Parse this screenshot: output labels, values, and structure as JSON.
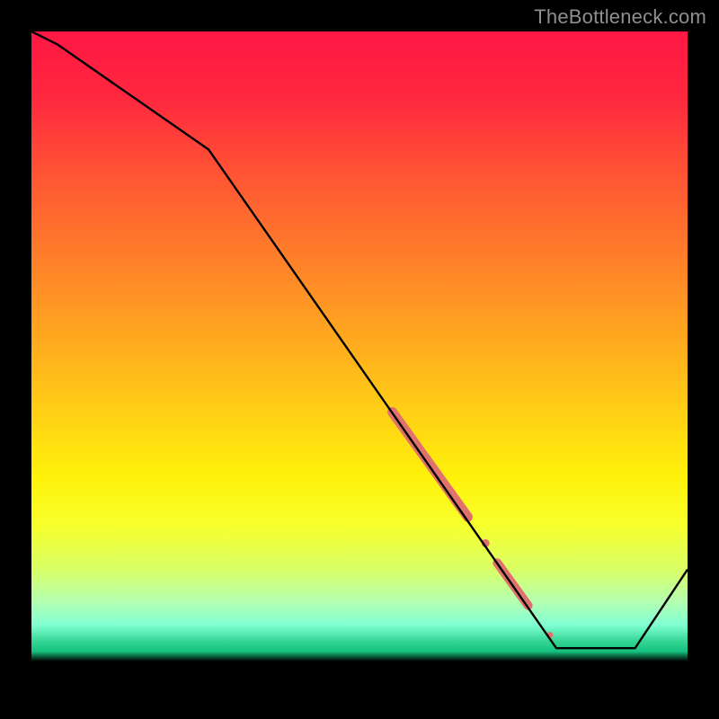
{
  "watermark": "TheBottleneck.com",
  "chart_data": {
    "type": "line",
    "title": "",
    "xlabel": "",
    "ylabel": "",
    "xlim": [
      0,
      100
    ],
    "ylim": [
      0,
      100
    ],
    "grid": false,
    "legend": false,
    "background_gradient_stops": [
      {
        "offset": 0.0,
        "color": "#ff1744"
      },
      {
        "offset": 0.1,
        "color": "#ff283f"
      },
      {
        "offset": 0.22,
        "color": "#ff5534"
      },
      {
        "offset": 0.34,
        "color": "#ff7d2a"
      },
      {
        "offset": 0.46,
        "color": "#ffa61f"
      },
      {
        "offset": 0.58,
        "color": "#ffcf15"
      },
      {
        "offset": 0.68,
        "color": "#fff20a"
      },
      {
        "offset": 0.75,
        "color": "#f7ff2a"
      },
      {
        "offset": 0.82,
        "color": "#d9ff66"
      },
      {
        "offset": 0.87,
        "color": "#b3ffb3"
      },
      {
        "offset": 0.905,
        "color": "#7fffd4"
      },
      {
        "offset": 0.93,
        "color": "#33d492"
      },
      {
        "offset": 0.945,
        "color": "#15c27e"
      },
      {
        "offset": 0.96,
        "color": "#000000"
      },
      {
        "offset": 1.0,
        "color": "#000000"
      }
    ],
    "series": [
      {
        "name": "bottleneck-curve",
        "color": "#000000",
        "x": [
          0,
          4,
          27,
          80,
          92,
          100
        ],
        "y": [
          100,
          98,
          82,
          6,
          6,
          18
        ]
      }
    ],
    "highlight_segments": [
      {
        "name": "highlight-1",
        "color": "#e1716d",
        "x": [
          55,
          66.5
        ],
        "y": [
          42,
          26
        ],
        "width": 11
      },
      {
        "name": "highlight-2-dot",
        "color": "#e1716d",
        "x": [
          69.2
        ],
        "y": [
          22
        ],
        "width": 9
      },
      {
        "name": "highlight-3",
        "color": "#e1716d",
        "x": [
          71,
          75.7
        ],
        "y": [
          19,
          12.5
        ],
        "width": 10
      },
      {
        "name": "highlight-4-dot",
        "color": "#e1716d",
        "x": [
          79
        ],
        "y": [
          8
        ],
        "width": 7
      }
    ]
  }
}
